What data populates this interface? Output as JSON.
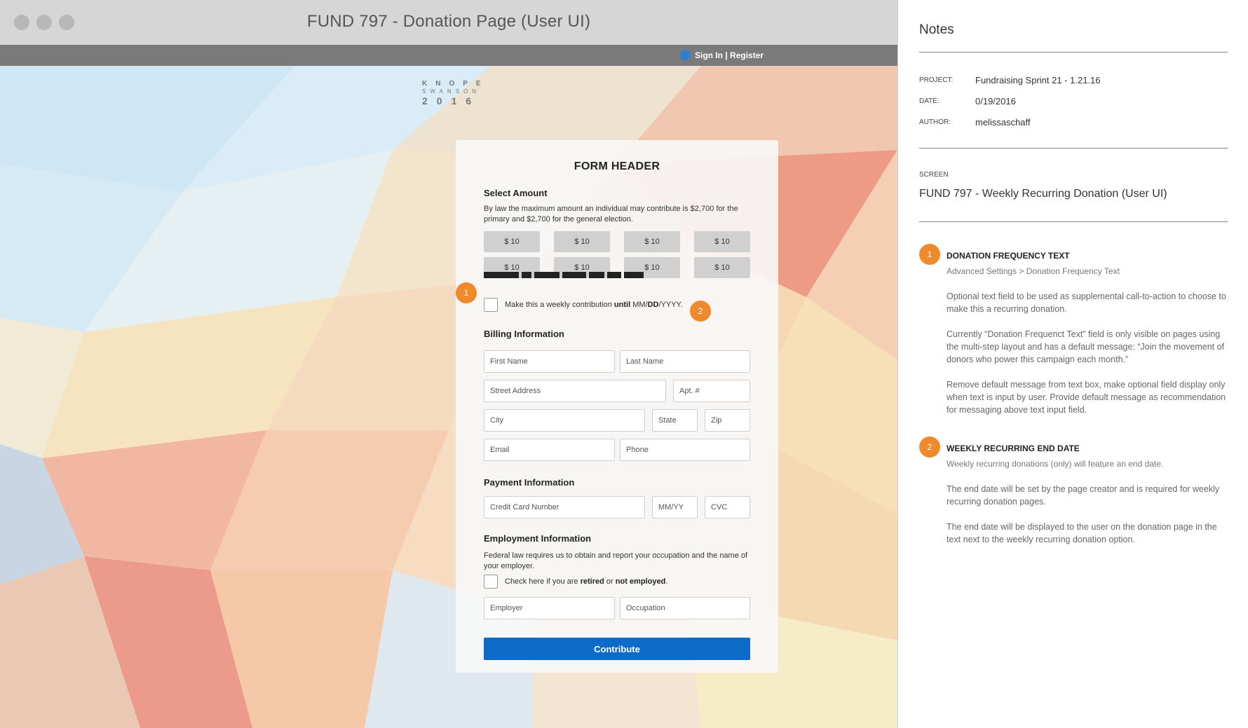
{
  "window": {
    "title": "FUND 797 - Donation Page (User UI)"
  },
  "nav": {
    "signin": "Sign In | Register"
  },
  "logo": {
    "line1": "KNOPE",
    "line2": "SWANSON",
    "line3": "2016"
  },
  "form": {
    "header": "FORM HEADER",
    "select_amount": {
      "title": "Select Amount",
      "description": "By law the maximum amount an individual may contribute is $2,700 for the primary and $2,700 for the general election.",
      "amounts": [
        "$ 10",
        "$ 10",
        "$ 10",
        "$ 10",
        "$ 10",
        "$ 10",
        "$ 10",
        "$ 10"
      ]
    },
    "weekly": {
      "label_pre": "Make this a weekly contribution ",
      "label_until": "until",
      "label_date_mm": " MM/",
      "label_date_dd": "DD",
      "label_date_yyyy": "/YYYY",
      "label_end": "."
    },
    "billing": {
      "title": "Billing Information",
      "first_name": "First Name",
      "last_name": "Last Name",
      "street": "Street Address",
      "apt": "Apt. #",
      "city": "City",
      "state": "State",
      "zip": "Zip",
      "email": "Email",
      "phone": "Phone"
    },
    "payment": {
      "title": "Payment Information",
      "card": "Credit Card Number",
      "exp": "MM/YY",
      "cvc": "CVC"
    },
    "employment": {
      "title": "Employment Information",
      "description": "Federal law requires us to obtain and report your occupation and the name of your employer.",
      "check_pre": "Check here if you are ",
      "check_retired": "retired",
      "check_or": " or ",
      "check_not": "not employed",
      "check_end": ".",
      "employer": "Employer",
      "occupation": "Occupation"
    },
    "contribute": "Contribute"
  },
  "badges": {
    "one": "1",
    "two": "2"
  },
  "notes": {
    "title": "Notes",
    "project_key": "PROJECT:",
    "project_val": "Fundraising Sprint 21 - 1.21.16",
    "date_key": "DATE:",
    "date_val": "0/19/2016",
    "author_key": "AUTHOR:",
    "author_val": "melissaschaff",
    "screen_key": "SCREEN",
    "screen_val": "FUND 797 - Weekly Recurring Donation (User UI)",
    "items": [
      {
        "num": "1",
        "head": "DONATION FREQUENCY TEXT",
        "sub": "Advanced Settings > Donation Frequency Text",
        "paras": [
          "Optional text field to be used as supplemental call-to-action to choose to make this a recurring donation.",
          "Currently “Donation Frequenct Text” field is only visible on pages using the multi-step layout and has a default message: “Join the movement of donors who power this campaign each month.”",
          "Remove default message from text box, make optional field display only when text is input by user. Provide default message as recommendation for messaging above text input field."
        ]
      },
      {
        "num": "2",
        "head": "WEEKLY RECURRING END DATE",
        "sub": "Weekly recurring donations (only) will feature an end date.",
        "paras": [
          "The end date will be set by the page creator and is required for weekly recurring donation pages.",
          "The end date will be displayed to the user on the donation page in the text next to the weekly recurring donation option."
        ]
      }
    ]
  },
  "colors": {
    "accent_blue": "#0b6bc7",
    "badge_orange": "#ef8a2c",
    "titlebar": "#d6d6d6",
    "nav": "#7a7a7a"
  }
}
